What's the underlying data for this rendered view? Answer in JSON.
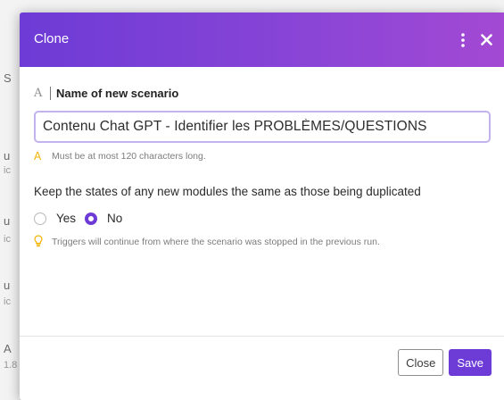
{
  "background": {
    "fragments": [
      "S",
      "u",
      "ic",
      "u",
      "ic",
      "u",
      "ic",
      "A",
      "1.8"
    ]
  },
  "modal": {
    "title": "Clone",
    "header_icons": [
      "kebab-menu-icon",
      "close-icon"
    ],
    "accent_color": "#6d3bd6",
    "field": {
      "type_icon": "text-type-icon",
      "type_glyph": "A",
      "label": "Name of new scenario",
      "value": "Contenu Chat GPT - Identifier les PROBLÈMES/QUESTIONS",
      "warning_icon": "warning-icon",
      "warning_glyph": "A",
      "warning": "Must be at most 120 characters long."
    },
    "question": "Keep the states of any new modules the same as those being duplicated",
    "options": [
      {
        "label": "Yes",
        "checked": false
      },
      {
        "label": "No",
        "checked": true
      }
    ],
    "hint_icon": "lightbulb-icon",
    "hint": "Triggers will continue from where the scenario was stopped in the previous run.",
    "buttons": {
      "close": "Close",
      "save": "Save"
    }
  }
}
